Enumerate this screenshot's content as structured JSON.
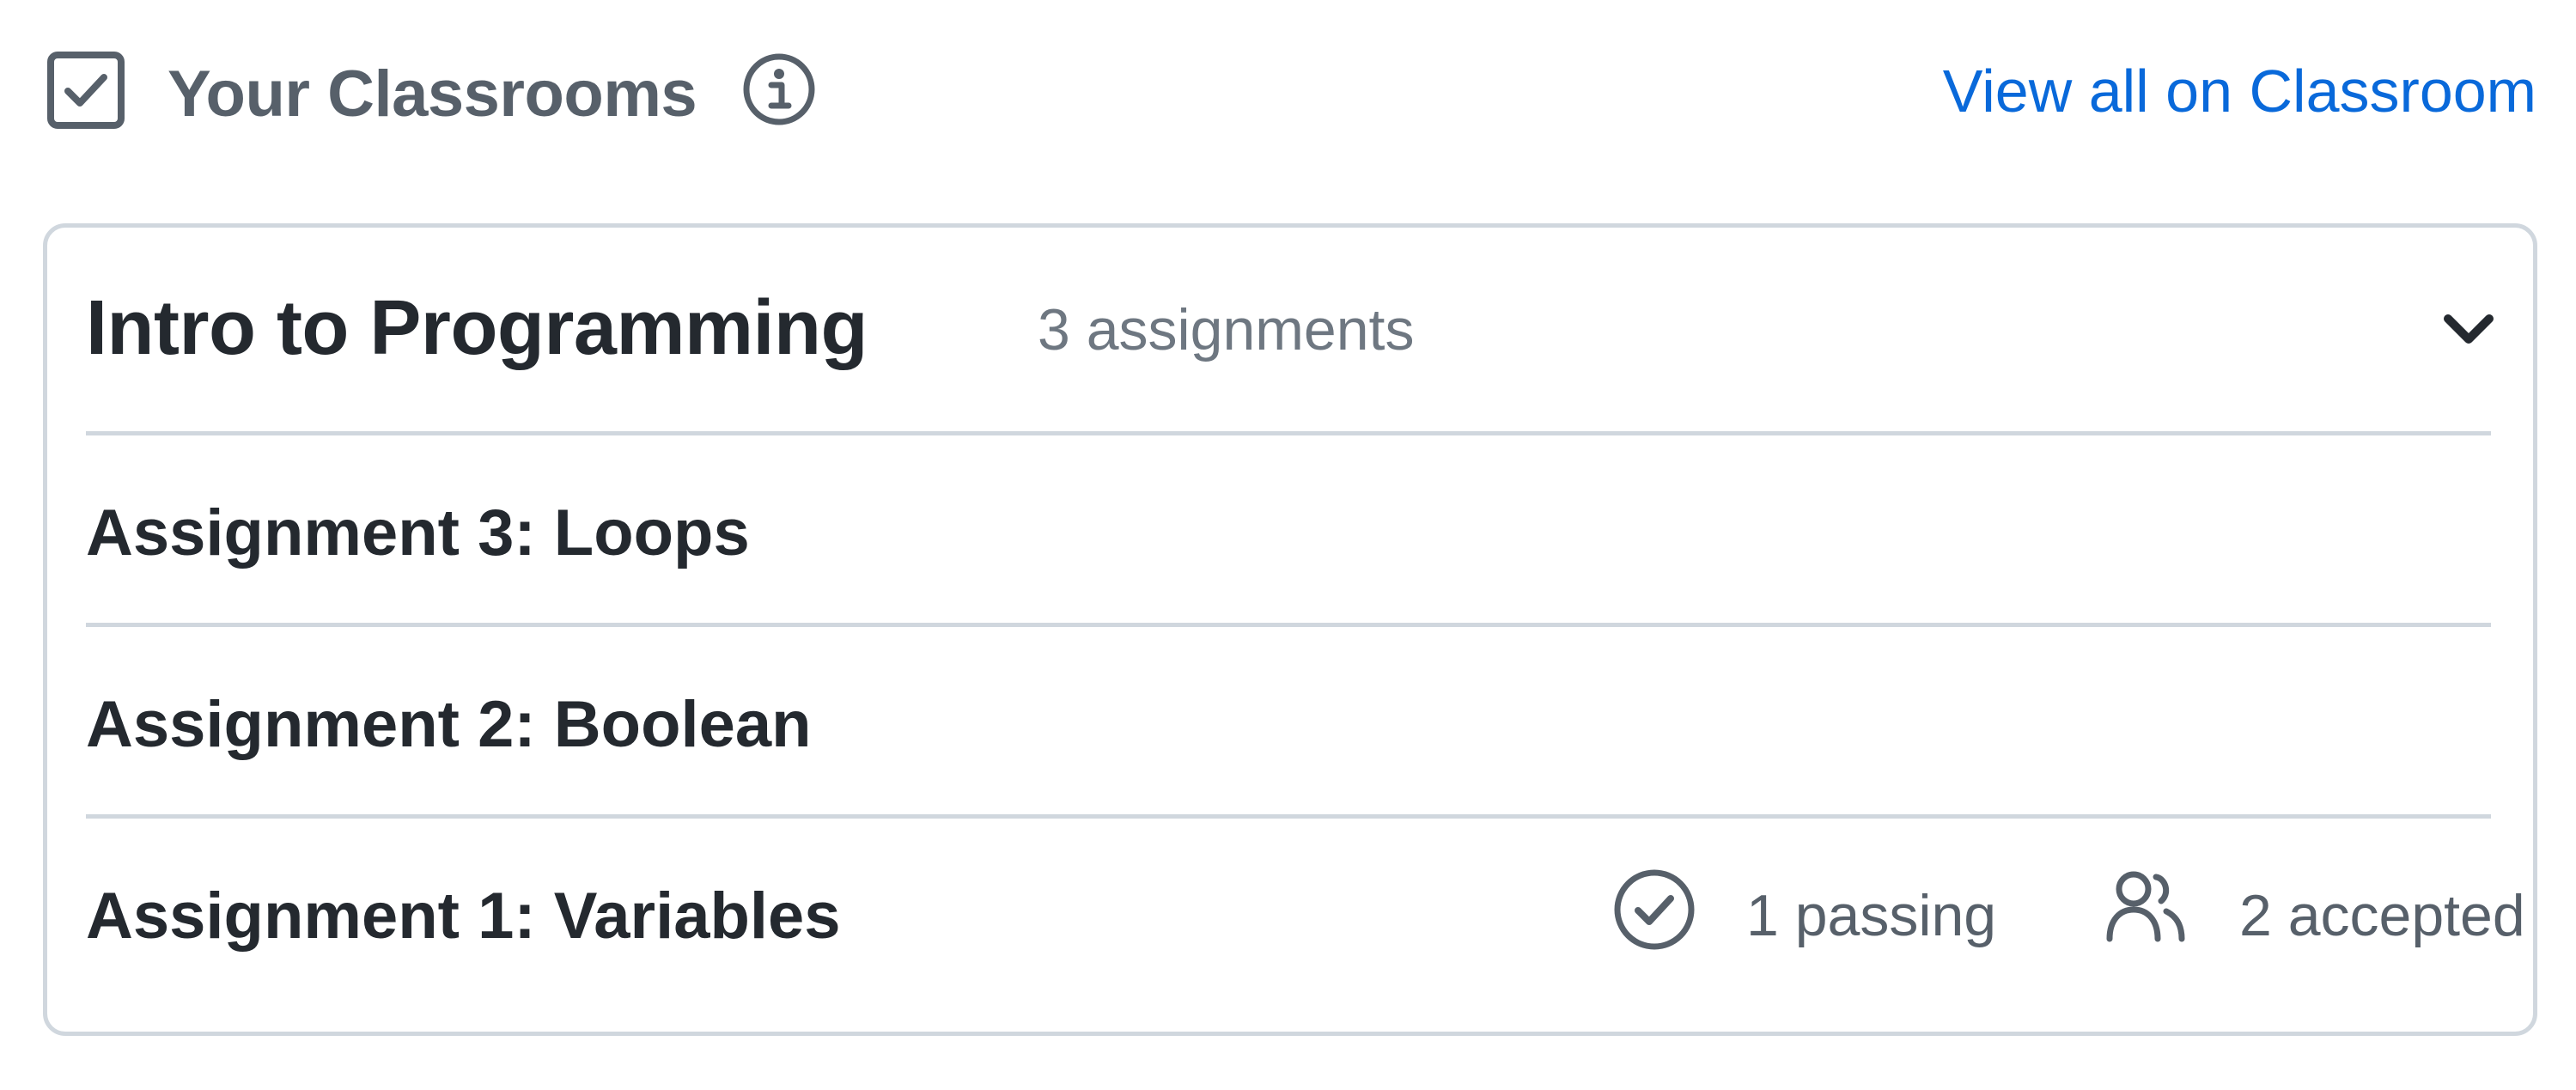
{
  "header": {
    "title": "Your Classrooms",
    "view_all_label": "View all on Classroom",
    "icons": [
      "checkbox-checked-icon",
      "info-icon"
    ]
  },
  "classroom": {
    "name": "Intro to Programming",
    "assignment_count": "3 assignments",
    "expanded": true,
    "assignments": [
      {
        "name": "Assignment 3: Loops"
      },
      {
        "name": "Assignment 2: Boolean"
      },
      {
        "name": "Assignment 1: Variables",
        "passing": "1 passing",
        "accepted": "2 accepted"
      }
    ]
  },
  "colors": {
    "link": "#0969da",
    "heading": "#24292f",
    "muted": "#57606a",
    "muted_light": "#6e7781",
    "border": "#d0d7de"
  }
}
